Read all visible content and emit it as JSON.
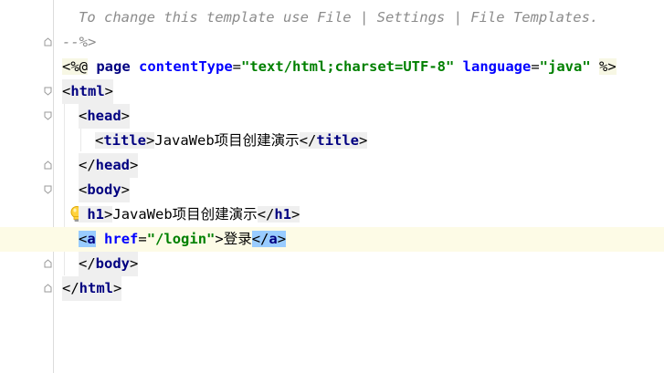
{
  "editor": {
    "lines": {
      "l1": {
        "comment": "To change this template use File | Settings | File Templates."
      },
      "l2": {
        "comment": "--%>"
      },
      "l3": {
        "open": "<%@",
        "directive": "page",
        "attr1": "contentType",
        "eq1": "=",
        "val1": "\"text/html;charset=UTF-8\"",
        "attr2": "language",
        "eq2": "=",
        "val2": "\"java\"",
        "close": "%>"
      },
      "l4": {
        "lt": "<",
        "tag": "html",
        "gt": ">"
      },
      "l5": {
        "lt": "<",
        "tag": "head",
        "gt": ">"
      },
      "l6": {
        "lt": "<",
        "tag": "title",
        "gt": ">",
        "text": "JavaWeb项目创建演示",
        "clt": "</",
        "ctag": "title",
        "cgt": ">"
      },
      "l7": {
        "lt": "</",
        "tag": "head",
        "gt": ">"
      },
      "l8": {
        "lt": "<",
        "tag": "body",
        "gt": ">"
      },
      "l9": {
        "lt": "<",
        "tag": "h1",
        "gt": ">",
        "text": "JavaWeb项目创建演示",
        "clt": "</",
        "ctag": "h1",
        "cgt": ">"
      },
      "l10": {
        "lt": "<",
        "tag": "a",
        "attr": "href",
        "eq": "=",
        "val": "\"/login\"",
        "gt": ">",
        "text": "登录",
        "clt": "</",
        "ctag": "a",
        "cgt": ">"
      },
      "l11": {
        "lt": "</",
        "tag": "body",
        "gt": ">"
      },
      "l12": {
        "lt": "</",
        "tag": "html",
        "gt": ">"
      }
    },
    "colors": {
      "tag": "#000080",
      "attribute": "#0000ff",
      "string": "#008000",
      "comment": "#8c8c8c",
      "current_line": "#fdfbe6",
      "tag_match": "#99ccff"
    },
    "icons": [
      "fold-icon",
      "intention-bulb-icon"
    ]
  }
}
